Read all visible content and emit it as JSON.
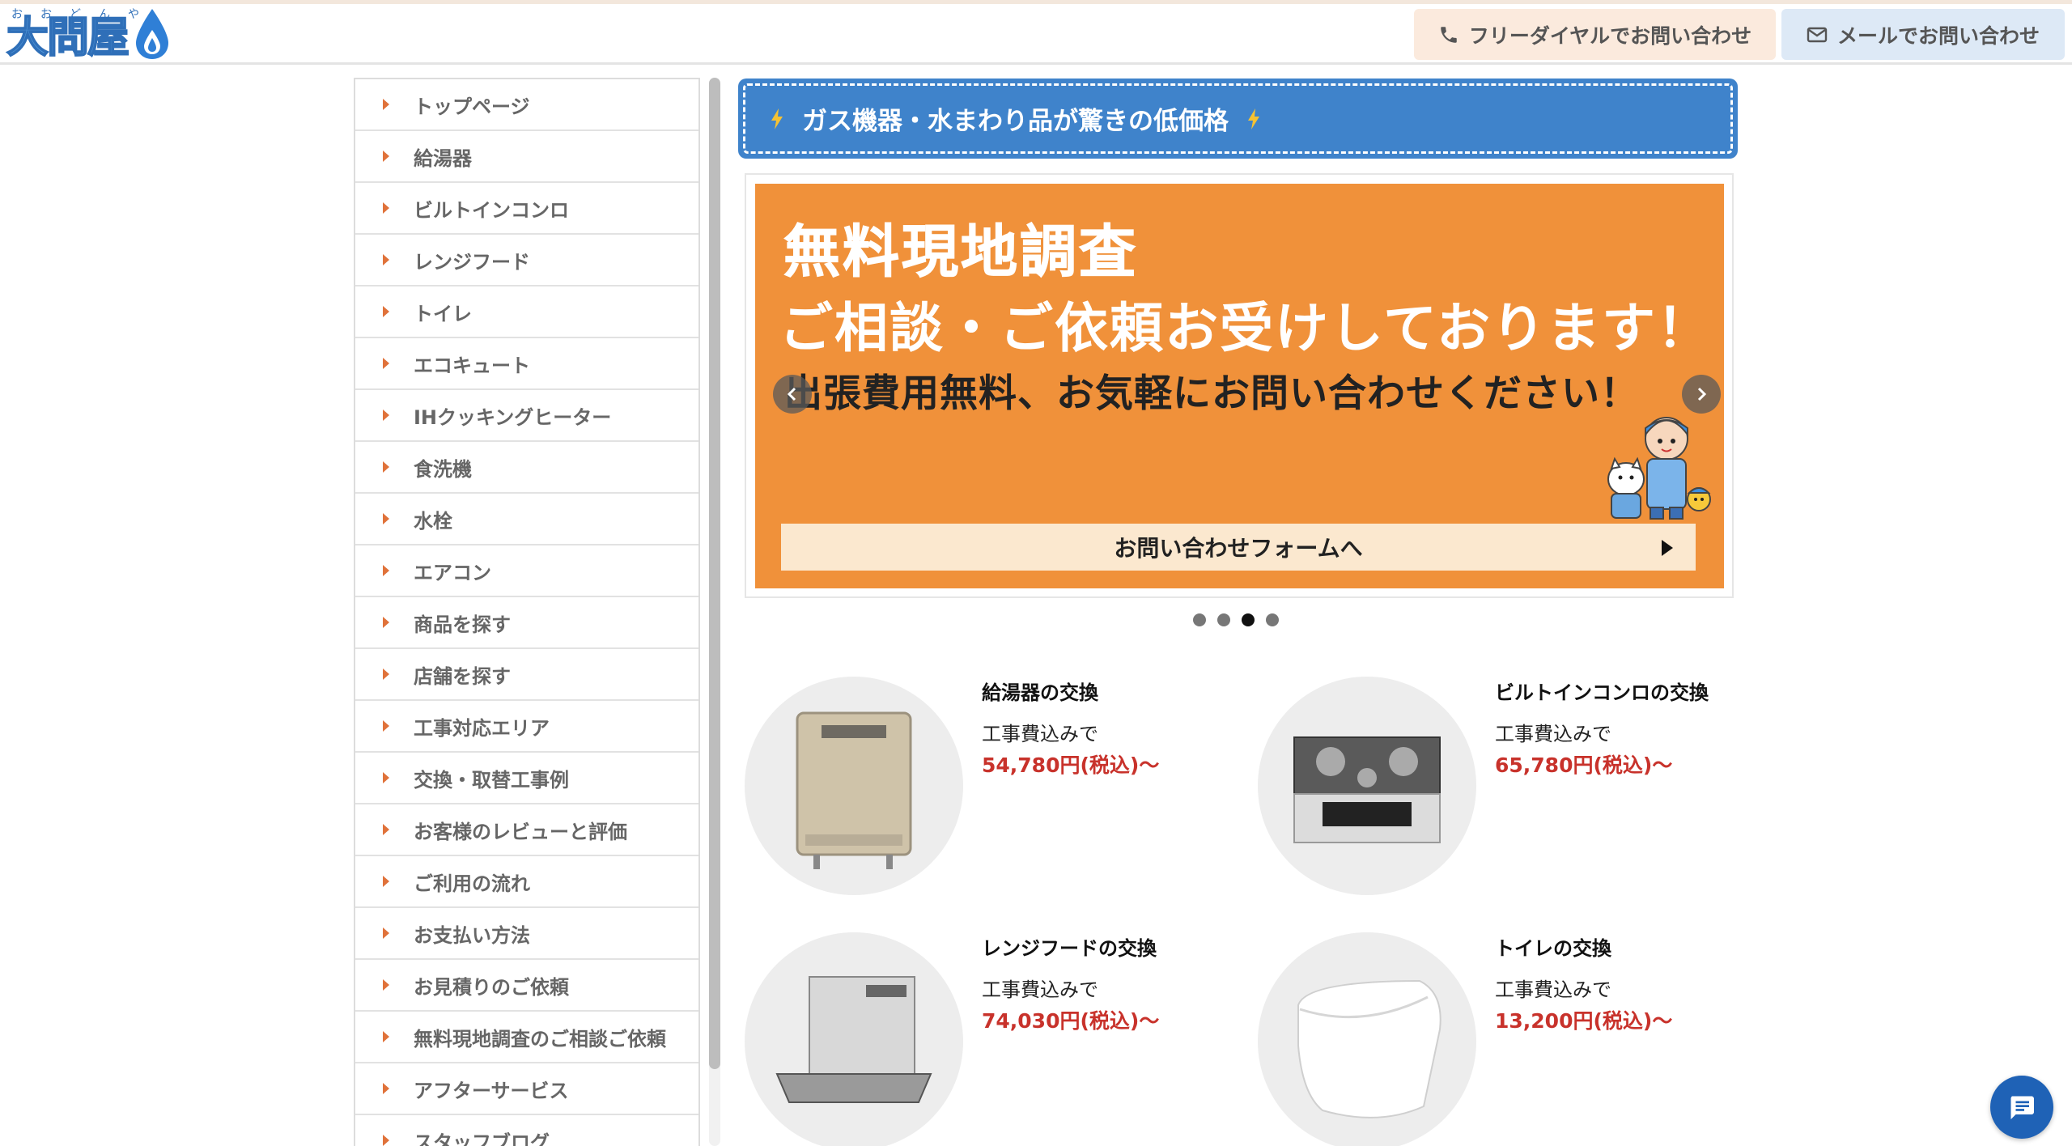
{
  "header": {
    "logo_text": "大問屋",
    "logo_ruby": "おおどんや",
    "tel_label": "フリーダイヤルでお問い合わせ",
    "mail_label": "メールでお問い合わせ"
  },
  "sidebar": {
    "items": [
      {
        "label": "トップページ"
      },
      {
        "label": "給湯器"
      },
      {
        "label": "ビルトインコンロ"
      },
      {
        "label": "レンジフード"
      },
      {
        "label": "トイレ"
      },
      {
        "label": "エコキュート"
      },
      {
        "label": "IHクッキングヒーター"
      },
      {
        "label": "食洗機"
      },
      {
        "label": "水栓"
      },
      {
        "label": "エアコン"
      },
      {
        "label": "商品を探す"
      },
      {
        "label": "店舗を探す"
      },
      {
        "label": "工事対応エリア"
      },
      {
        "label": "交換・取替工事例"
      },
      {
        "label": "お客様のレビューと評価"
      },
      {
        "label": "ご利用の流れ"
      },
      {
        "label": "お支払い方法"
      },
      {
        "label": "お見積りのご依頼"
      },
      {
        "label": "無料現地調査のご相談ご依頼"
      },
      {
        "label": "アフターサービス"
      },
      {
        "label": "スタッフブログ"
      }
    ]
  },
  "banner": {
    "text": "ガス機器・水まわり品が驚きの低価格"
  },
  "slider": {
    "headline": "無料現地調査",
    "subheadline": "ご相談・ご依頼お受けしております！",
    "note": "出張費用無料、お気軽にお問い合わせください！",
    "cta_label": "お問い合わせフォームへ",
    "slide_count": 4,
    "active_index": 2
  },
  "products": [
    {
      "title": "給湯器の交換",
      "sub": "工事費込みで",
      "price": "54,780円(税込)〜"
    },
    {
      "title": "ビルトインコンロの交換",
      "sub": "工事費込みで",
      "price": "65,780円(税込)〜"
    },
    {
      "title": "レンジフードの交換",
      "sub": "工事費込みで",
      "price": "74,030円(税込)〜"
    },
    {
      "title": "トイレの交換",
      "sub": "工事費込みで",
      "price": "13,200円(税込)〜"
    }
  ],
  "colors": {
    "accent_orange": "#f0913a",
    "banner_blue": "#3f83cb",
    "price_red": "#c8322b",
    "chat_blue": "#1f62b6"
  }
}
